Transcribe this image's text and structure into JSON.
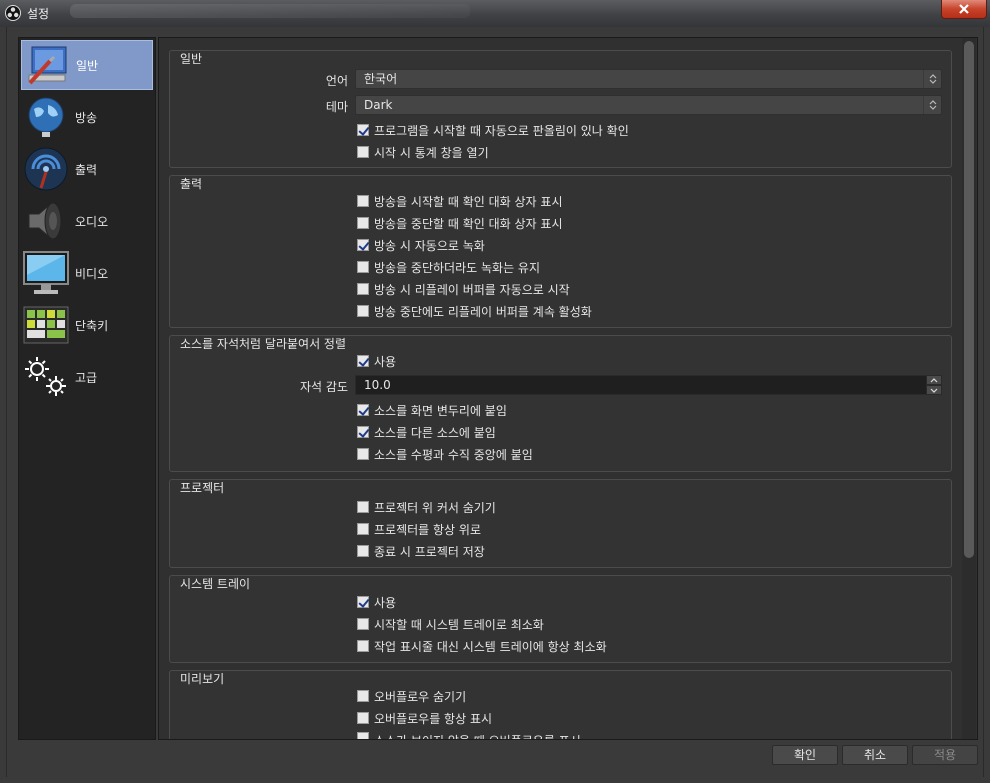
{
  "window": {
    "title": "설정"
  },
  "sidebar": {
    "items": [
      {
        "label": "일반",
        "icon": "general-icon"
      },
      {
        "label": "방송",
        "icon": "globe-icon"
      },
      {
        "label": "출력",
        "icon": "broadcast-icon"
      },
      {
        "label": "오디오",
        "icon": "speaker-icon"
      },
      {
        "label": "비디오",
        "icon": "monitor-icon"
      },
      {
        "label": "단축키",
        "icon": "keyboard-icon"
      },
      {
        "label": "고급",
        "icon": "gears-icon"
      }
    ]
  },
  "general": {
    "title": "일반",
    "language_label": "언어",
    "language_value": "한국어",
    "theme_label": "테마",
    "theme_value": "Dark",
    "check_updates": {
      "label": "프로그램을 시작할 때 자동으로 판올림이 있나 확인",
      "checked": true
    },
    "open_stats": {
      "label": "시작 시 통계 창을 열기",
      "checked": false
    }
  },
  "output": {
    "title": "출력",
    "items": [
      {
        "label": "방송을 시작할 때 확인 대화 상자 표시",
        "checked": false
      },
      {
        "label": "방송을 중단할 때 확인 대화 상자 표시",
        "checked": false
      },
      {
        "label": "방송 시 자동으로 녹화",
        "checked": true
      },
      {
        "label": "방송을 중단하더라도 녹화는 유지",
        "checked": false
      },
      {
        "label": "방송 시 리플레이 버퍼를 자동으로 시작",
        "checked": false
      },
      {
        "label": "방송 중단에도 리플레이 버퍼를 계속 활성화",
        "checked": false
      }
    ]
  },
  "snapping": {
    "title": "소스를 자석처럼 달라붙여서 정렬",
    "enable": {
      "label": "사용",
      "checked": true
    },
    "sensitivity_label": "자석 감도",
    "sensitivity_value": "10.0",
    "items": [
      {
        "label": "소스를 화면 변두리에 붙임",
        "checked": true
      },
      {
        "label": "소스를 다른 소스에 붙임",
        "checked": true
      },
      {
        "label": "소스를 수평과 수직 중앙에 붙임",
        "checked": false
      }
    ]
  },
  "projector": {
    "title": "프로젝터",
    "items": [
      {
        "label": "프로젝터 위 커서 숨기기",
        "checked": false
      },
      {
        "label": "프로젝터를 항상 위로",
        "checked": false
      },
      {
        "label": "종료 시 프로젝터 저장",
        "checked": false
      }
    ]
  },
  "tray": {
    "title": "시스템 트레이",
    "items": [
      {
        "label": "사용",
        "checked": true
      },
      {
        "label": "시작할 때 시스템 트레이로 최소화",
        "checked": false
      },
      {
        "label": "작업 표시줄 대신 시스템 트레이에 항상 최소화",
        "checked": false
      }
    ]
  },
  "preview": {
    "title": "미리보기",
    "items": [
      {
        "label": "오버플로우 숨기기",
        "checked": false
      },
      {
        "label": "오버플로우를 항상 표시",
        "checked": false
      },
      {
        "label": "소스가 보이지 않을 때 오버플로우를 표시",
        "checked": false
      }
    ]
  },
  "footer": {
    "ok": "확인",
    "cancel": "취소",
    "apply": "적용"
  },
  "colors": {
    "accent": "#8099c8",
    "background": "#3a3a3a",
    "close": "#c7432a"
  }
}
